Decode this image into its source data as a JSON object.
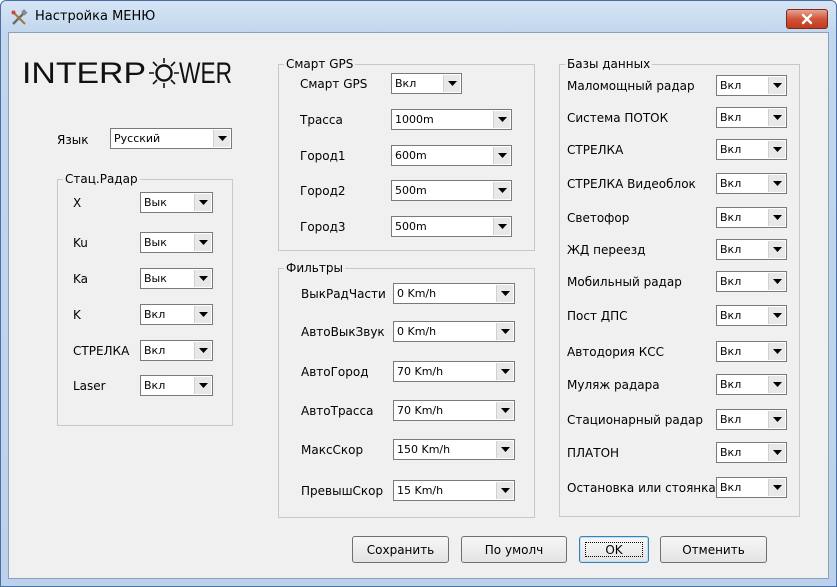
{
  "window": {
    "title": "Настройка МЕНЮ"
  },
  "logo": {
    "text": "INTERPOWER",
    "left": "INTERP",
    "right": "WER"
  },
  "language": {
    "label": "Язык",
    "value": "Русский"
  },
  "stat_radar": {
    "title": "Стац.Радар",
    "rows": [
      {
        "label": "X",
        "value": "Вык"
      },
      {
        "label": "Ku",
        "value": "Вык"
      },
      {
        "label": "Ka",
        "value": "Вык"
      },
      {
        "label": "K",
        "value": "Вкл"
      },
      {
        "label": "СТРЕЛКА",
        "value": "Вкл"
      },
      {
        "label": "Laser",
        "value": "Вкл"
      }
    ]
  },
  "smart_gps": {
    "title": "Смарт GPS",
    "rows": [
      {
        "label": "Смарт GPS",
        "value": "Вкл"
      },
      {
        "label": "Трасса",
        "value": "1000m"
      },
      {
        "label": "Город1",
        "value": "600m"
      },
      {
        "label": "Город2",
        "value": "500m"
      },
      {
        "label": "Город3",
        "value": "500m"
      }
    ]
  },
  "filters": {
    "title": "Фильтры",
    "rows": [
      {
        "label": "ВыкРадЧасти",
        "value": "0 Km/h"
      },
      {
        "label": "АвтоВыкЗвук",
        "value": "0 Km/h"
      },
      {
        "label": "АвтоГород",
        "value": "70 Km/h"
      },
      {
        "label": "АвтоТрасса",
        "value": "70 Km/h"
      },
      {
        "label": "МаксСкор",
        "value": "150 Km/h"
      },
      {
        "label": "ПревышСкор",
        "value": "15 Km/h"
      }
    ]
  },
  "databases": {
    "title": "Базы данных",
    "rows": [
      {
        "label": "Маломощный радар",
        "value": "Вкл"
      },
      {
        "label": "Система ПОТОК",
        "value": "Вкл"
      },
      {
        "label": "СТРЕЛКА",
        "value": "Вкл"
      },
      {
        "label": "СТРЕЛКА Видеоблок",
        "value": "Вкл"
      },
      {
        "label": "Светофор",
        "value": "Вкл"
      },
      {
        "label": "ЖД переезд",
        "value": "Вкл"
      },
      {
        "label": "Мобильный радар",
        "value": "Вкл"
      },
      {
        "label": "Пост ДПС",
        "value": "Вкл"
      },
      {
        "label": "Автодория КСС",
        "value": "Вкл"
      },
      {
        "label": "Муляж радара",
        "value": "Вкл"
      },
      {
        "label": "Стационарный радар",
        "value": "Вкл"
      },
      {
        "label": "ПЛАТОН",
        "value": "Вкл"
      },
      {
        "label": "Остановка или стоянка",
        "value": "Вкл"
      }
    ]
  },
  "buttons": {
    "save": "Сохранить",
    "default": "По умолч",
    "ok": "OK",
    "cancel": "Отменить"
  },
  "colors": {
    "close": "#c23a1e",
    "frame": "#bcd2ec",
    "client": "#f0f0f0"
  }
}
